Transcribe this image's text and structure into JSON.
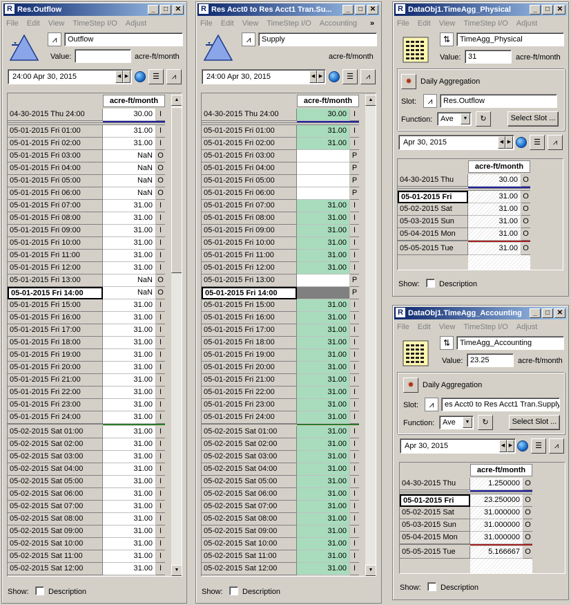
{
  "win1": {
    "title": "Res.Outflow",
    "menu": [
      "File",
      "Edit",
      "View",
      "TimeStep I/O",
      "Adjust"
    ],
    "slot_name": "Outflow",
    "value_label": "Value:",
    "value": "",
    "units": "acre-ft/month",
    "date": "24:00 Apr 30, 2015",
    "col_header": "acre-ft/month",
    "show_label": "Show:",
    "desc_label": "Description",
    "rows": [
      {
        "d": "04-30-2015 Thu 24:00",
        "v": "30.00",
        "f": "I"
      },
      {
        "d": "05-01-2015 Fri 01:00",
        "v": "31.00",
        "f": "I"
      },
      {
        "d": "05-01-2015 Fri 02:00",
        "v": "31.00",
        "f": "I"
      },
      {
        "d": "05-01-2015 Fri 03:00",
        "v": "NaN",
        "f": "O"
      },
      {
        "d": "05-01-2015 Fri 04:00",
        "v": "NaN",
        "f": "O"
      },
      {
        "d": "05-01-2015 Fri 05:00",
        "v": "NaN",
        "f": "O"
      },
      {
        "d": "05-01-2015 Fri 06:00",
        "v": "NaN",
        "f": "O"
      },
      {
        "d": "05-01-2015 Fri 07:00",
        "v": "31.00",
        "f": "I"
      },
      {
        "d": "05-01-2015 Fri 08:00",
        "v": "31.00",
        "f": "I"
      },
      {
        "d": "05-01-2015 Fri 09:00",
        "v": "31.00",
        "f": "I"
      },
      {
        "d": "05-01-2015 Fri 10:00",
        "v": "31.00",
        "f": "I"
      },
      {
        "d": "05-01-2015 Fri 11:00",
        "v": "31.00",
        "f": "I"
      },
      {
        "d": "05-01-2015 Fri 12:00",
        "v": "31.00",
        "f": "I"
      },
      {
        "d": "05-01-2015 Fri 13:00",
        "v": "NaN",
        "f": "O"
      },
      {
        "d": "05-01-2015 Fri 14:00",
        "v": "NaN",
        "f": "O"
      },
      {
        "d": "05-01-2015 Fri 15:00",
        "v": "31.00",
        "f": "I"
      },
      {
        "d": "05-01-2015 Fri 16:00",
        "v": "31.00",
        "f": "I"
      },
      {
        "d": "05-01-2015 Fri 17:00",
        "v": "31.00",
        "f": "I"
      },
      {
        "d": "05-01-2015 Fri 18:00",
        "v": "31.00",
        "f": "I"
      },
      {
        "d": "05-01-2015 Fri 19:00",
        "v": "31.00",
        "f": "I"
      },
      {
        "d": "05-01-2015 Fri 20:00",
        "v": "31.00",
        "f": "I"
      },
      {
        "d": "05-01-2015 Fri 21:00",
        "v": "31.00",
        "f": "I"
      },
      {
        "d": "05-01-2015 Fri 22:00",
        "v": "31.00",
        "f": "I"
      },
      {
        "d": "05-01-2015 Fri 23:00",
        "v": "31.00",
        "f": "I"
      },
      {
        "d": "05-01-2015 Fri 24:00",
        "v": "31.00",
        "f": "I"
      },
      {
        "d": "05-02-2015 Sat 01:00",
        "v": "31.00",
        "f": "I"
      },
      {
        "d": "05-02-2015 Sat 02:00",
        "v": "31.00",
        "f": "I"
      },
      {
        "d": "05-02-2015 Sat 03:00",
        "v": "31.00",
        "f": "I"
      },
      {
        "d": "05-02-2015 Sat 04:00",
        "v": "31.00",
        "f": "I"
      },
      {
        "d": "05-02-2015 Sat 05:00",
        "v": "31.00",
        "f": "I"
      },
      {
        "d": "05-02-2015 Sat 06:00",
        "v": "31.00",
        "f": "I"
      },
      {
        "d": "05-02-2015 Sat 07:00",
        "v": "31.00",
        "f": "I"
      },
      {
        "d": "05-02-2015 Sat 08:00",
        "v": "31.00",
        "f": "I"
      },
      {
        "d": "05-02-2015 Sat 09:00",
        "v": "31.00",
        "f": "I"
      },
      {
        "d": "05-02-2015 Sat 10:00",
        "v": "31.00",
        "f": "I"
      },
      {
        "d": "05-02-2015 Sat 11:00",
        "v": "31.00",
        "f": "I"
      },
      {
        "d": "05-02-2015 Sat 12:00",
        "v": "31.00",
        "f": "I"
      }
    ]
  },
  "win2": {
    "title": "Res Acct0 to Res Acct1 Tran.Su...",
    "menu": [
      "File",
      "Edit",
      "View",
      "TimeStep I/O",
      "Accounting"
    ],
    "more": "»",
    "slot_name": "Supply",
    "units": "acre-ft/month",
    "date": "24:00 Apr 30, 2015",
    "col_header": "acre-ft/month",
    "show_label": "Show:",
    "desc_label": "Description",
    "rows": [
      {
        "d": "04-30-2015 Thu 24:00",
        "v": "30.00",
        "f": "I",
        "c": "green"
      },
      {
        "d": "05-01-2015 Fri 01:00",
        "v": "31.00",
        "f": "I",
        "c": "green"
      },
      {
        "d": "05-01-2015 Fri 02:00",
        "v": "31.00",
        "f": "I",
        "c": "green"
      },
      {
        "d": "05-01-2015 Fri 03:00",
        "v": "",
        "f": "P",
        "c": "white"
      },
      {
        "d": "05-01-2015 Fri 04:00",
        "v": "",
        "f": "P",
        "c": "white"
      },
      {
        "d": "05-01-2015 Fri 05:00",
        "v": "",
        "f": "P",
        "c": "white"
      },
      {
        "d": "05-01-2015 Fri 06:00",
        "v": "",
        "f": "P",
        "c": "white"
      },
      {
        "d": "05-01-2015 Fri 07:00",
        "v": "31.00",
        "f": "I",
        "c": "green"
      },
      {
        "d": "05-01-2015 Fri 08:00",
        "v": "31.00",
        "f": "I",
        "c": "green"
      },
      {
        "d": "05-01-2015 Fri 09:00",
        "v": "31.00",
        "f": "I",
        "c": "green"
      },
      {
        "d": "05-01-2015 Fri 10:00",
        "v": "31.00",
        "f": "I",
        "c": "green"
      },
      {
        "d": "05-01-2015 Fri 11:00",
        "v": "31.00",
        "f": "I",
        "c": "green"
      },
      {
        "d": "05-01-2015 Fri 12:00",
        "v": "31.00",
        "f": "I",
        "c": "green"
      },
      {
        "d": "05-01-2015 Fri 13:00",
        "v": "",
        "f": "P",
        "c": "white"
      },
      {
        "d": "05-01-2015 Fri 14:00",
        "v": "",
        "f": "P",
        "c": "gray"
      },
      {
        "d": "05-01-2015 Fri 15:00",
        "v": "31.00",
        "f": "I",
        "c": "green"
      },
      {
        "d": "05-01-2015 Fri 16:00",
        "v": "31.00",
        "f": "I",
        "c": "green"
      },
      {
        "d": "05-01-2015 Fri 17:00",
        "v": "31.00",
        "f": "I",
        "c": "green"
      },
      {
        "d": "05-01-2015 Fri 18:00",
        "v": "31.00",
        "f": "I",
        "c": "green"
      },
      {
        "d": "05-01-2015 Fri 19:00",
        "v": "31.00",
        "f": "I",
        "c": "green"
      },
      {
        "d": "05-01-2015 Fri 20:00",
        "v": "31.00",
        "f": "I",
        "c": "green"
      },
      {
        "d": "05-01-2015 Fri 21:00",
        "v": "31.00",
        "f": "I",
        "c": "green"
      },
      {
        "d": "05-01-2015 Fri 22:00",
        "v": "31.00",
        "f": "I",
        "c": "green"
      },
      {
        "d": "05-01-2015 Fri 23:00",
        "v": "31.00",
        "f": "I",
        "c": "green"
      },
      {
        "d": "05-01-2015 Fri 24:00",
        "v": "31.00",
        "f": "I",
        "c": "green"
      },
      {
        "d": "05-02-2015 Sat 01:00",
        "v": "31.00",
        "f": "I",
        "c": "green"
      },
      {
        "d": "05-02-2015 Sat 02:00",
        "v": "31.00",
        "f": "I",
        "c": "green"
      },
      {
        "d": "05-02-2015 Sat 03:00",
        "v": "31.00",
        "f": "I",
        "c": "green"
      },
      {
        "d": "05-02-2015 Sat 04:00",
        "v": "31.00",
        "f": "I",
        "c": "green"
      },
      {
        "d": "05-02-2015 Sat 05:00",
        "v": "31.00",
        "f": "I",
        "c": "green"
      },
      {
        "d": "05-02-2015 Sat 06:00",
        "v": "31.00",
        "f": "I",
        "c": "green"
      },
      {
        "d": "05-02-2015 Sat 07:00",
        "v": "31.00",
        "f": "I",
        "c": "green"
      },
      {
        "d": "05-02-2015 Sat 08:00",
        "v": "31.00",
        "f": "I",
        "c": "green"
      },
      {
        "d": "05-02-2015 Sat 09:00",
        "v": "31.00",
        "f": "I",
        "c": "green"
      },
      {
        "d": "05-02-2015 Sat 10:00",
        "v": "31.00",
        "f": "I",
        "c": "green"
      },
      {
        "d": "05-02-2015 Sat 11:00",
        "v": "31.00",
        "f": "I",
        "c": "green"
      },
      {
        "d": "05-02-2015 Sat 12:00",
        "v": "31.00",
        "f": "I",
        "c": "green"
      }
    ]
  },
  "win3": {
    "title": "DataObj1.TimeAgg_Physical",
    "menu": [
      "File",
      "Edit",
      "View",
      "TimeStep I/O",
      "Adjust"
    ],
    "slot_name": "TimeAgg_Physical",
    "value_label": "Value:",
    "value": "31",
    "units": "acre-ft/month",
    "agg_label": "Daily Aggregation",
    "slot_label": "Slot:",
    "slot_ref": "Res.Outflow",
    "function_label": "Function:",
    "function_value": "Ave",
    "select_slot": "Select Slot ...",
    "date": "Apr 30, 2015",
    "col_header": "acre-ft/month",
    "show_label": "Show:",
    "desc_label": "Description",
    "rows": [
      {
        "d": "04-30-2015 Thu",
        "v": "30.00",
        "f": "O"
      },
      {
        "d": "05-01-2015 Fri",
        "v": "31.00",
        "f": "O"
      },
      {
        "d": "05-02-2015 Sat",
        "v": "31.00",
        "f": "O"
      },
      {
        "d": "05-03-2015 Sun",
        "v": "31.00",
        "f": "O"
      },
      {
        "d": "05-04-2015 Mon",
        "v": "31.00",
        "f": "O"
      },
      {
        "d": "05-05-2015 Tue",
        "v": "31.00",
        "f": "O"
      }
    ]
  },
  "win4": {
    "title": "DataObj1.TimeAgg_Accounting",
    "menu": [
      "File",
      "Edit",
      "View",
      "TimeStep I/O",
      "Adjust"
    ],
    "slot_name": "TimeAgg_Accounting",
    "value_label": "Value:",
    "value": "23.25",
    "units": "acre-ft/month",
    "agg_label": "Daily Aggregation",
    "slot_label": "Slot:",
    "slot_ref": "es Acct0 to Res Acct1 Tran.Supply",
    "function_label": "Function:",
    "function_value": "Ave",
    "select_slot": "Select Slot ...",
    "date": "Apr 30, 2015",
    "col_header": "acre-ft/month",
    "show_label": "Show:",
    "desc_label": "Description",
    "rows": [
      {
        "d": "04-30-2015 Thu",
        "v": "1.250000",
        "f": "O"
      },
      {
        "d": "05-01-2015 Fri",
        "v": "23.250000",
        "f": "O"
      },
      {
        "d": "05-02-2015 Sat",
        "v": "31.000000",
        "f": "O"
      },
      {
        "d": "05-03-2015 Sun",
        "v": "31.000000",
        "f": "O"
      },
      {
        "d": "05-04-2015 Mon",
        "v": "31.000000",
        "f": "O"
      },
      {
        "d": "05-05-2015 Tue",
        "v": "5.166667",
        "f": "O"
      }
    ]
  }
}
